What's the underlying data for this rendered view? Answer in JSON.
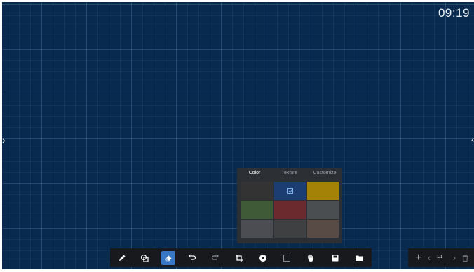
{
  "status": {
    "time": "09:19"
  },
  "edges": {
    "left_arrow": "›",
    "right_arrow": "‹"
  },
  "palette": {
    "tabs": [
      "Color",
      "Texture",
      "Customize"
    ],
    "active_tab": "Color",
    "swatches": [
      {
        "color": "#333333",
        "selected": false
      },
      {
        "color": "#1c3d72",
        "selected": true
      },
      {
        "color": "#a48207",
        "selected": false
      },
      {
        "color": "#3f5a36",
        "selected": false
      },
      {
        "color": "#6a2a2e",
        "selected": false
      },
      {
        "color": "#4a4e50",
        "selected": false
      },
      {
        "color": "#4b4d53",
        "selected": false
      },
      {
        "color": "#3f4042",
        "selected": false
      },
      {
        "color": "#584b46",
        "selected": false
      }
    ]
  },
  "toolbar": {
    "tools": [
      "pen-icon",
      "shape-icon",
      "eraser-icon",
      "undo-icon",
      "redo-icon",
      "crop-icon",
      "disc-icon",
      "select-icon",
      "hand-icon",
      "save-icon",
      "folder-icon"
    ],
    "active_tool": "eraser-icon"
  },
  "pager": {
    "add": "+",
    "prev": "‹",
    "page": "1/1",
    "next": "›",
    "delete_icon": "trash-icon"
  },
  "colors": {
    "board": "#082a4e",
    "toolbar": "#17191c",
    "panel": "#2c2f33",
    "accent": "#3877c5"
  }
}
